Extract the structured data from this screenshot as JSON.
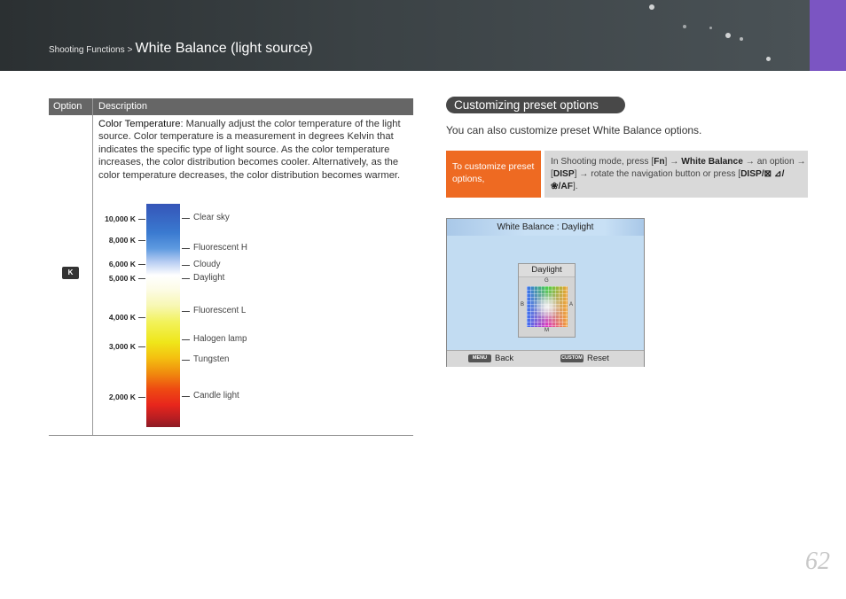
{
  "header": {
    "breadcrumb_small": "Shooting Functions",
    "separator": ">",
    "title": "White Balance (light source)"
  },
  "table": {
    "col_option": "Option",
    "col_description": "Description",
    "option_icon": "K",
    "description_term": "Color Temperature",
    "description_body": ": Manually adjust the color temperature of the light source. Color temperature is a measurement in degrees Kelvin that indicates the specific type of light source. As the color temperature increases, the color distribution becomes cooler. Alternatively, as the color temperature decreases, the color distribution becomes warmer.",
    "kelvin_labels": [
      "10,000 K",
      "8,000 K",
      "6,000 K",
      "5,000 K",
      "4,000 K",
      "3,000 K",
      "2,000 K"
    ],
    "light_sources": [
      "Clear sky",
      "Fluorescent H",
      "Cloudy",
      "Daylight",
      "Fluorescent L",
      "Halogen lamp",
      "Tungsten",
      "Candle light"
    ]
  },
  "customize": {
    "heading": "Customizing preset options",
    "intro": "You can also customize preset White Balance options.",
    "step_label": "To customize preset options,",
    "instr_1": "In Shooting mode, press [",
    "instr_fn": "Fn",
    "instr_2": "] → ",
    "instr_wb": "White Balance",
    "instr_3": " → an option → [",
    "instr_disp": "DISP",
    "instr_4": "] → rotate the navigation button or press [",
    "instr_keys": "DISP/⊠ ⊿/❀/AF",
    "instr_5": "]."
  },
  "screen": {
    "title": "White Balance : Daylight",
    "panel_title": "Daylight",
    "axis_g": "G",
    "axis_b": "B",
    "axis_a": "A",
    "axis_m": "M",
    "menu_key": "MENU",
    "back_label": "Back",
    "custom_key": "CUSTOM",
    "reset_label": "Reset"
  },
  "page_number": "62",
  "colors": {
    "header_bg": "#3b4245",
    "accent_purple": "#7b55c2",
    "step_orange": "#ee6a22",
    "table_header": "#666666",
    "screen_bg": "#c2dcf2"
  }
}
